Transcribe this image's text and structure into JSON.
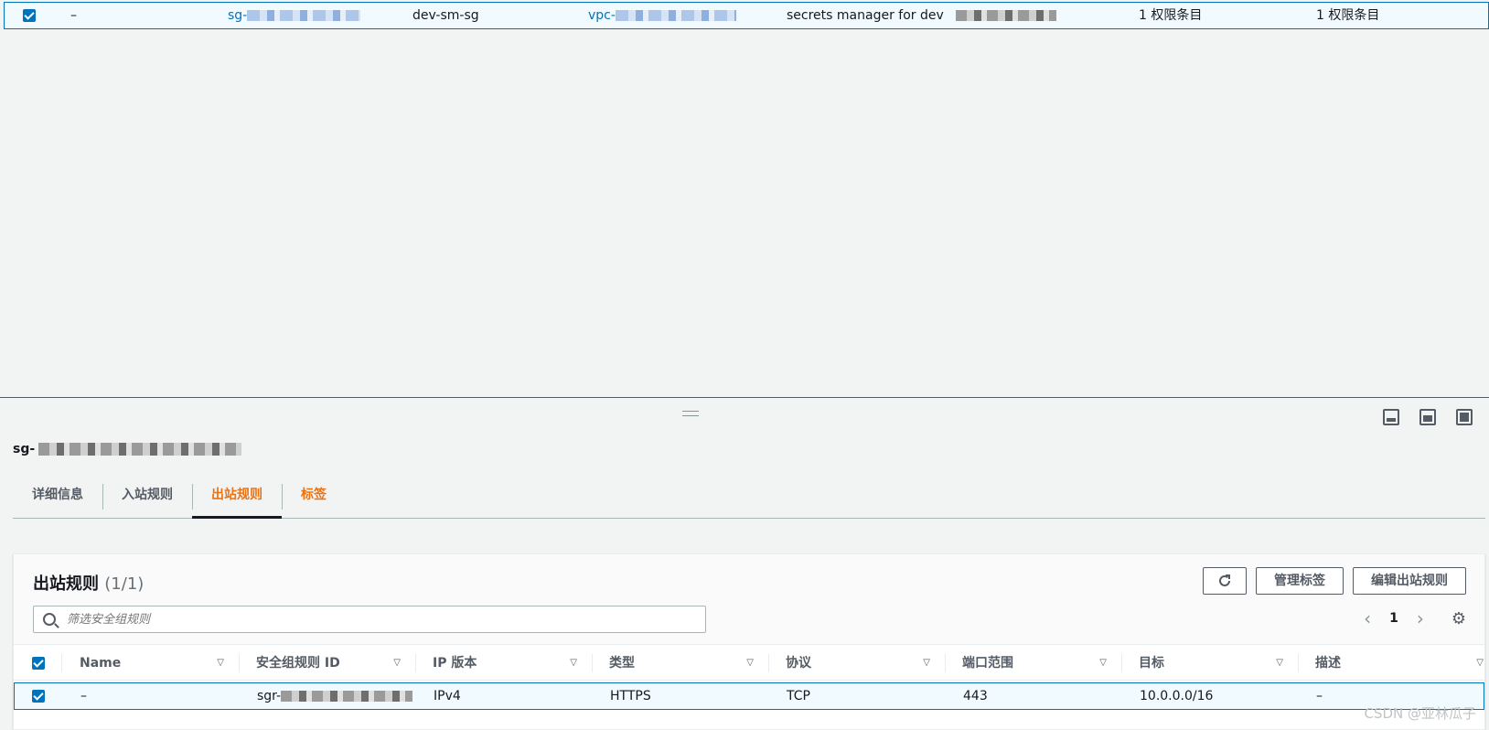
{
  "top_row": {
    "name": "–",
    "sg_prefix": "sg-",
    "group_name": "dev-sm-sg",
    "vpc_prefix": "vpc-",
    "description": "secrets manager for dev",
    "inbound_count": "1 权限条目",
    "outbound_count": "1 权限条目"
  },
  "details": {
    "sg_prefix": "sg-"
  },
  "tabs": [
    {
      "label": "详细信息"
    },
    {
      "label": "入站规则"
    },
    {
      "label": "出站规则"
    },
    {
      "label": "标签"
    }
  ],
  "rules_panel": {
    "title": "出站规则",
    "count": "(1/1)",
    "manage_tags_label": "管理标签",
    "edit_rules_label": "编辑出站规则",
    "search_placeholder": "筛选安全组规则",
    "page_number": "1"
  },
  "table": {
    "columns": [
      "Name",
      "安全组规则 ID",
      "IP 版本",
      "类型",
      "协议",
      "端口范围",
      "目标",
      "描述"
    ],
    "row": {
      "name": "–",
      "rule_id_prefix": "sgr-",
      "ip_version": "IPv4",
      "type": "HTTPS",
      "protocol": "TCP",
      "port_range": "443",
      "destination": "10.0.0.0/16",
      "description": "–"
    }
  },
  "watermark": "CSDN @亚林瓜子",
  "colors": {
    "accent_orange": "#ec7211",
    "link_blue": "#0073bb",
    "selected_row_bg": "#f1faff"
  }
}
